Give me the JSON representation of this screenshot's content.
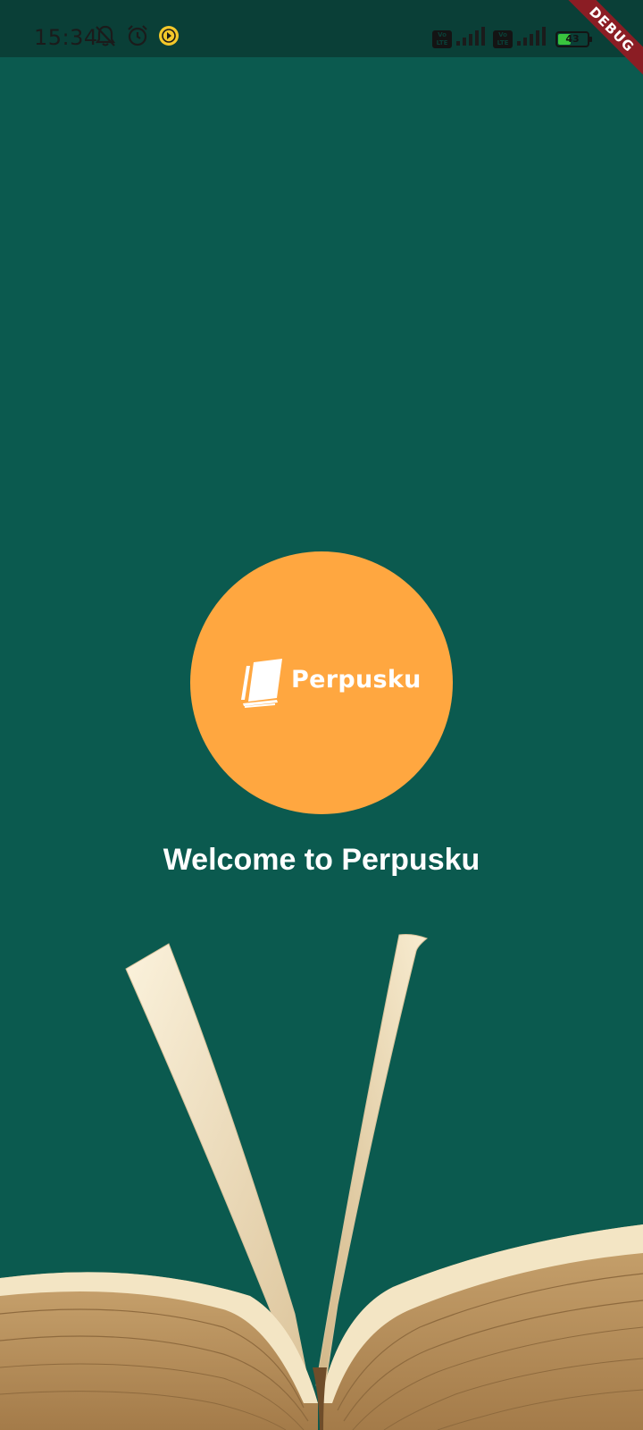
{
  "status_bar": {
    "time": "15:34",
    "icons": [
      "notifications-off-icon",
      "alarm-icon",
      "app-notification-icon",
      "volte-icon",
      "signal-icon",
      "volte-icon",
      "signal-icon",
      "battery-icon"
    ],
    "volte_label": "Vo LTE",
    "battery_level": "43"
  },
  "debug_banner": "DEBUG",
  "logo": {
    "text": "Perpusku",
    "icon": "book-stack-icon",
    "circle_color": "#ffa740"
  },
  "welcome": {
    "title": "Welcome to Perpusku"
  },
  "illustration": {
    "icon": "open-book-illustration"
  },
  "colors": {
    "background": "#0b5a4f",
    "status_bar": "#0a3f37",
    "accent": "#ffa740",
    "debug": "#8b1d24"
  }
}
